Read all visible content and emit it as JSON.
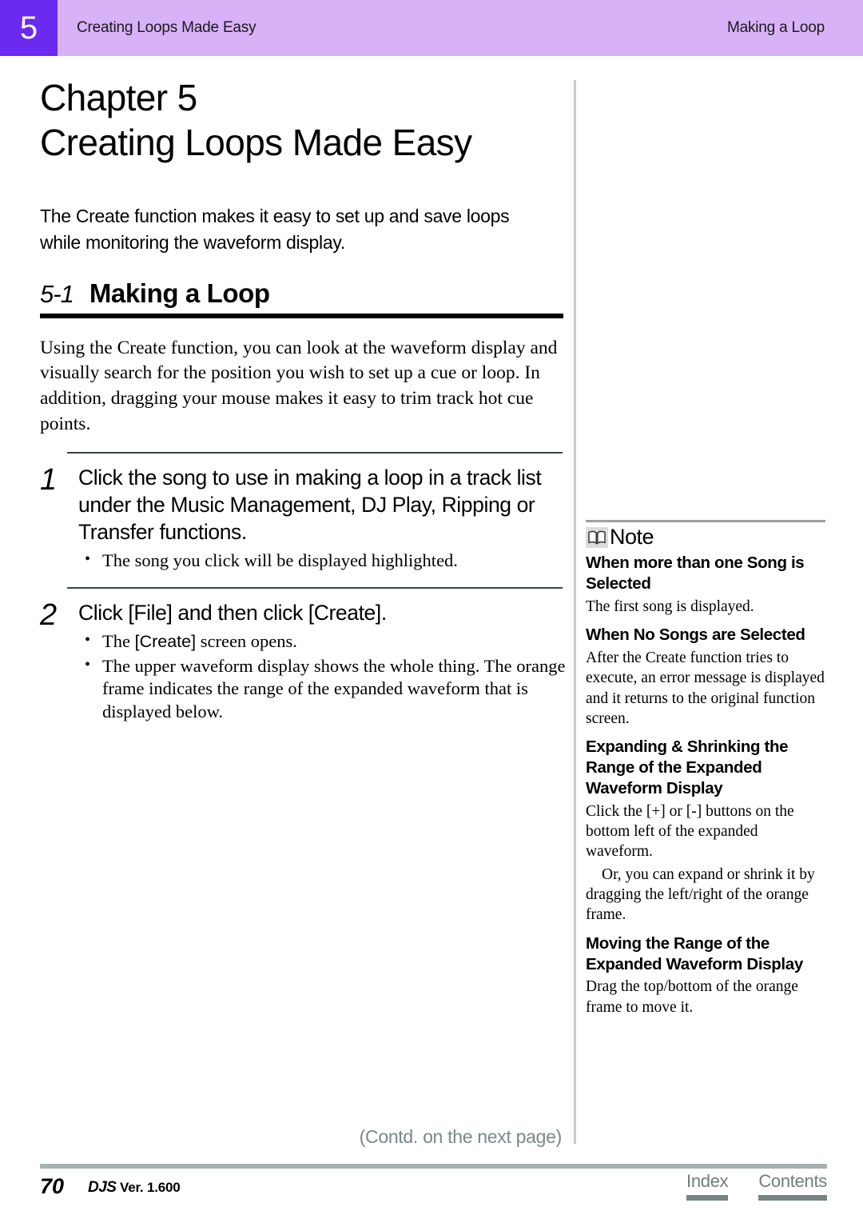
{
  "header": {
    "chapter_number": "5",
    "left_title": "Creating Loops Made Easy",
    "right_title": "Making a Loop"
  },
  "main": {
    "chapter_label": "Chapter 5",
    "chapter_title": "Creating Loops Made Easy",
    "intro": "The Create function makes it easy to set up and save loops while monitoring the waveform display.",
    "section": {
      "number": "5-1",
      "name": "Making a Loop"
    },
    "section_body": "Using the Create function, you can look at the waveform display and visually search for the position you wish to set up a cue or loop. In addition, dragging your mouse makes it easy to trim track hot cue points.",
    "steps": [
      {
        "number": "1",
        "title": "Click the song to use in making a loop in a track list under the Music Management, DJ Play, Ripping or Transfer functions.",
        "bullets": [
          {
            "text_before": "The song you click will be displayed highlighted.",
            "token": "",
            "text_after": ""
          }
        ]
      },
      {
        "number": "2",
        "title": "Click [File] and then click [Create].",
        "bullets": [
          {
            "text_before": "The ",
            "token": "[Create]",
            "text_after": " screen opens."
          },
          {
            "text_before": "The upper waveform display shows the whole thing. The orange frame indicates the range of the expanded waveform that is displayed below.",
            "token": "",
            "text_after": ""
          }
        ]
      }
    ]
  },
  "note": {
    "label": "Note",
    "icon": "open-book-icon",
    "entries": [
      {
        "heading": "When more than one Song is Selected",
        "body": "The first song is displayed."
      },
      {
        "heading": "When No Songs are Selected",
        "body": "After the Create function tries to execute, an error message is displayed and it returns to the original function screen."
      },
      {
        "heading": "Expanding & Shrinking the Range of the Expanded Waveform Display",
        "body": "Click the [+] or [-] buttons on the bottom left of the expanded waveform.",
        "body2": "Or, you can expand or shrink it by dragging the left/right of the orange frame."
      },
      {
        "heading": "Moving the Range of the Expanded Waveform Display",
        "body": "Drag the top/bottom of the orange frame to move it."
      }
    ]
  },
  "footer": {
    "contd": "(Contd. on the next page)",
    "page_number": "70",
    "brand": "DJS",
    "version": "Ver. 1.600",
    "links": [
      {
        "label": "Index"
      },
      {
        "label": "Contents"
      }
    ]
  },
  "colors": {
    "header_band": "#d8b2f7",
    "chapter_badge": "#6a2af0",
    "rule_dark": "#3a4347",
    "footer_rule": "#a8b2b2",
    "link": "#6f7d7d"
  }
}
